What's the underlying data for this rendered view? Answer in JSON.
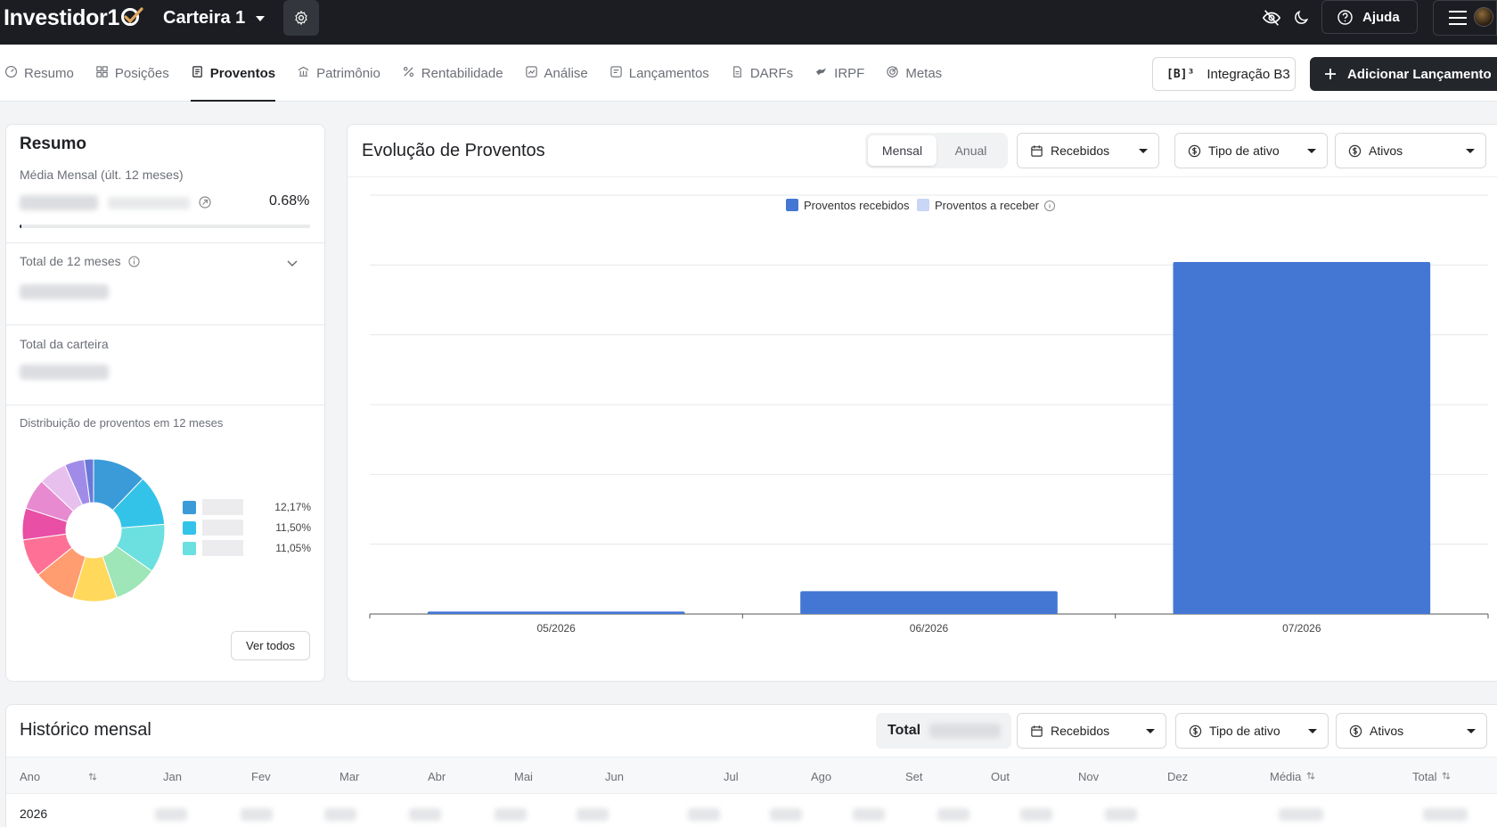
{
  "brand": {
    "name": "Investidor10"
  },
  "topbar": {
    "wallet": "Carteira 1",
    "help": "Ajuda"
  },
  "nav": {
    "tabs": [
      {
        "label": "Resumo",
        "icon": "gauge-icon"
      },
      {
        "label": "Posições",
        "icon": "grid-icon"
      },
      {
        "label": "Proventos",
        "icon": "receipt-icon"
      },
      {
        "label": "Patrimônio",
        "icon": "bank-icon"
      },
      {
        "label": "Rentabilidade",
        "icon": "percent-icon"
      },
      {
        "label": "Análise",
        "icon": "analysis-icon"
      },
      {
        "label": "Lançamentos",
        "icon": "edit-list-icon"
      },
      {
        "label": "DARFs",
        "icon": "document-icon"
      },
      {
        "label": "IRPF",
        "icon": "lion-icon"
      },
      {
        "label": "Metas",
        "icon": "target-icon"
      }
    ],
    "active": "Proventos",
    "b3_button": "Integração B3",
    "b3_mark": "[B]³",
    "add_button": "Adicionar Lançamento"
  },
  "resumo": {
    "title": "Resumo",
    "media_label": "Média Mensal (últ. 12 meses)",
    "media_pct": "0.68%",
    "media_progress": 0.0068,
    "total12_label": "Total de 12 meses",
    "total_carteira_label": "Total da carteira",
    "distrib_label": "Distribuição de proventos em 12 meses",
    "legend": [
      {
        "color": "#3b9bd9",
        "pct": "12,17%"
      },
      {
        "color": "#34c3e8",
        "pct": "11,50%"
      },
      {
        "color": "#6ce0e0",
        "pct": "11,05%"
      }
    ],
    "ver_todos": "Ver todos"
  },
  "evolucao": {
    "title": "Evolução de Proventos",
    "period_options": [
      "Mensal",
      "Anual"
    ],
    "period_selected": "Mensal",
    "filters": {
      "status": "Recebidos",
      "tipo": "Tipo de ativo",
      "ativos": "Ativos"
    }
  },
  "chart_data": {
    "type": "bar",
    "categories": [
      "05/2026",
      "06/2026",
      "07/2026"
    ],
    "series": [
      {
        "name": "Proventos recebidos",
        "values": [
          0.7,
          6.5,
          100
        ],
        "color": "#4477d4"
      },
      {
        "name": "Proventos a receber",
        "values": [
          0,
          0,
          0
        ],
        "color": "#c9d6f5"
      }
    ],
    "ylim": [
      0,
      119
    ],
    "grid": true,
    "legend": "top-center"
  },
  "historico": {
    "title": "Histórico mensal",
    "total_label": "Total",
    "filters": {
      "status": "Recebidos",
      "tipo": "Tipo de ativo",
      "ativos": "Ativos"
    },
    "columns": [
      "Ano",
      "Jan",
      "Fev",
      "Mar",
      "Abr",
      "Mai",
      "Jun",
      "Jul",
      "Ago",
      "Set",
      "Out",
      "Nov",
      "Dez",
      "Média",
      "Total"
    ],
    "rows": [
      {
        "year": "2026"
      }
    ]
  }
}
